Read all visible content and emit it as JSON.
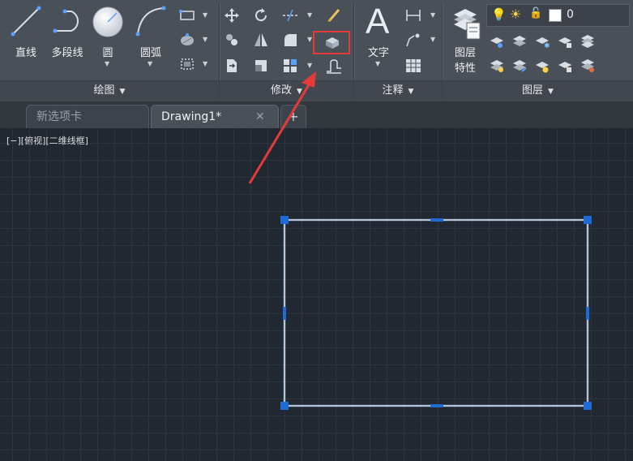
{
  "ribbon": {
    "panels": {
      "draw": {
        "title": "绘图",
        "tools": {
          "line": "直线",
          "polyline": "多段线",
          "circle": "圆",
          "arc": "圆弧"
        }
      },
      "modify": {
        "title": "修改"
      },
      "annotation": {
        "title": "注释",
        "tools": {
          "text": "文字"
        }
      },
      "layers": {
        "title": "图层",
        "tools": {
          "layer_properties_line1": "图层",
          "layer_properties_line2": "特性"
        },
        "current_layer": "0"
      }
    }
  },
  "tabs": [
    {
      "label": "新选项卡",
      "active": false
    },
    {
      "label": "Drawing1*",
      "active": true
    }
  ],
  "viewport": {
    "label": "[−][俯视][二维线框]"
  },
  "colors": {
    "accent_red": "#e53a3a",
    "grip_blue": "#1e6bd6",
    "rectangle_line": "#cfe3ff",
    "background": "#212832"
  }
}
